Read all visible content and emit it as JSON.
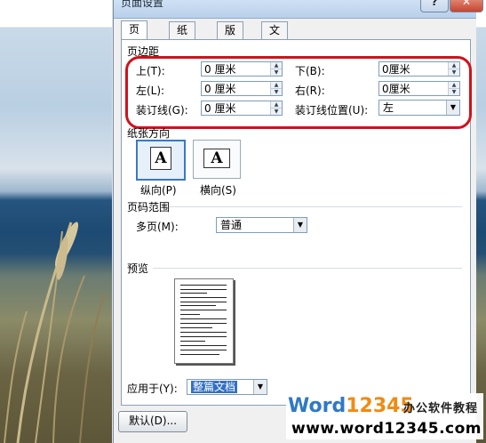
{
  "dialog": {
    "title": "页面设置",
    "help_btn": "?",
    "close_btn": "✕"
  },
  "tabs": [
    "页边距",
    "纸张",
    "版式",
    "文档网格"
  ],
  "margins": {
    "section": "页边距",
    "top_label": "上(T):",
    "top_value": "0 厘米",
    "bottom_label": "下(B):",
    "bottom_value": "0厘米",
    "left_label": "左(L):",
    "left_value": "0 厘米",
    "right_label": "右(R):",
    "right_value": "0厘米",
    "gutter_label": "装订线(G):",
    "gutter_value": "0 厘米",
    "gutter_pos_label": "装订线位置(U):",
    "gutter_pos_value": "左"
  },
  "orientation": {
    "section": "纸张方向",
    "portrait": "纵向(P)",
    "landscape": "横向(S)",
    "glyph": "A"
  },
  "pages": {
    "section": "页码范围",
    "multi_label": "多页(M):",
    "multi_value": "普通"
  },
  "preview": {
    "section": "预览",
    "apply_label": "应用于(Y):",
    "apply_value": "整篇文档"
  },
  "footer": {
    "default_btn": "默认(D)..."
  },
  "watermark": {
    "word": "Word",
    "num": "12345",
    "cn": "办公软件教程",
    "url": "www.word12345.com"
  },
  "colors": {
    "highlight_circle": "#d0121b",
    "selection": "#3a79c4"
  }
}
